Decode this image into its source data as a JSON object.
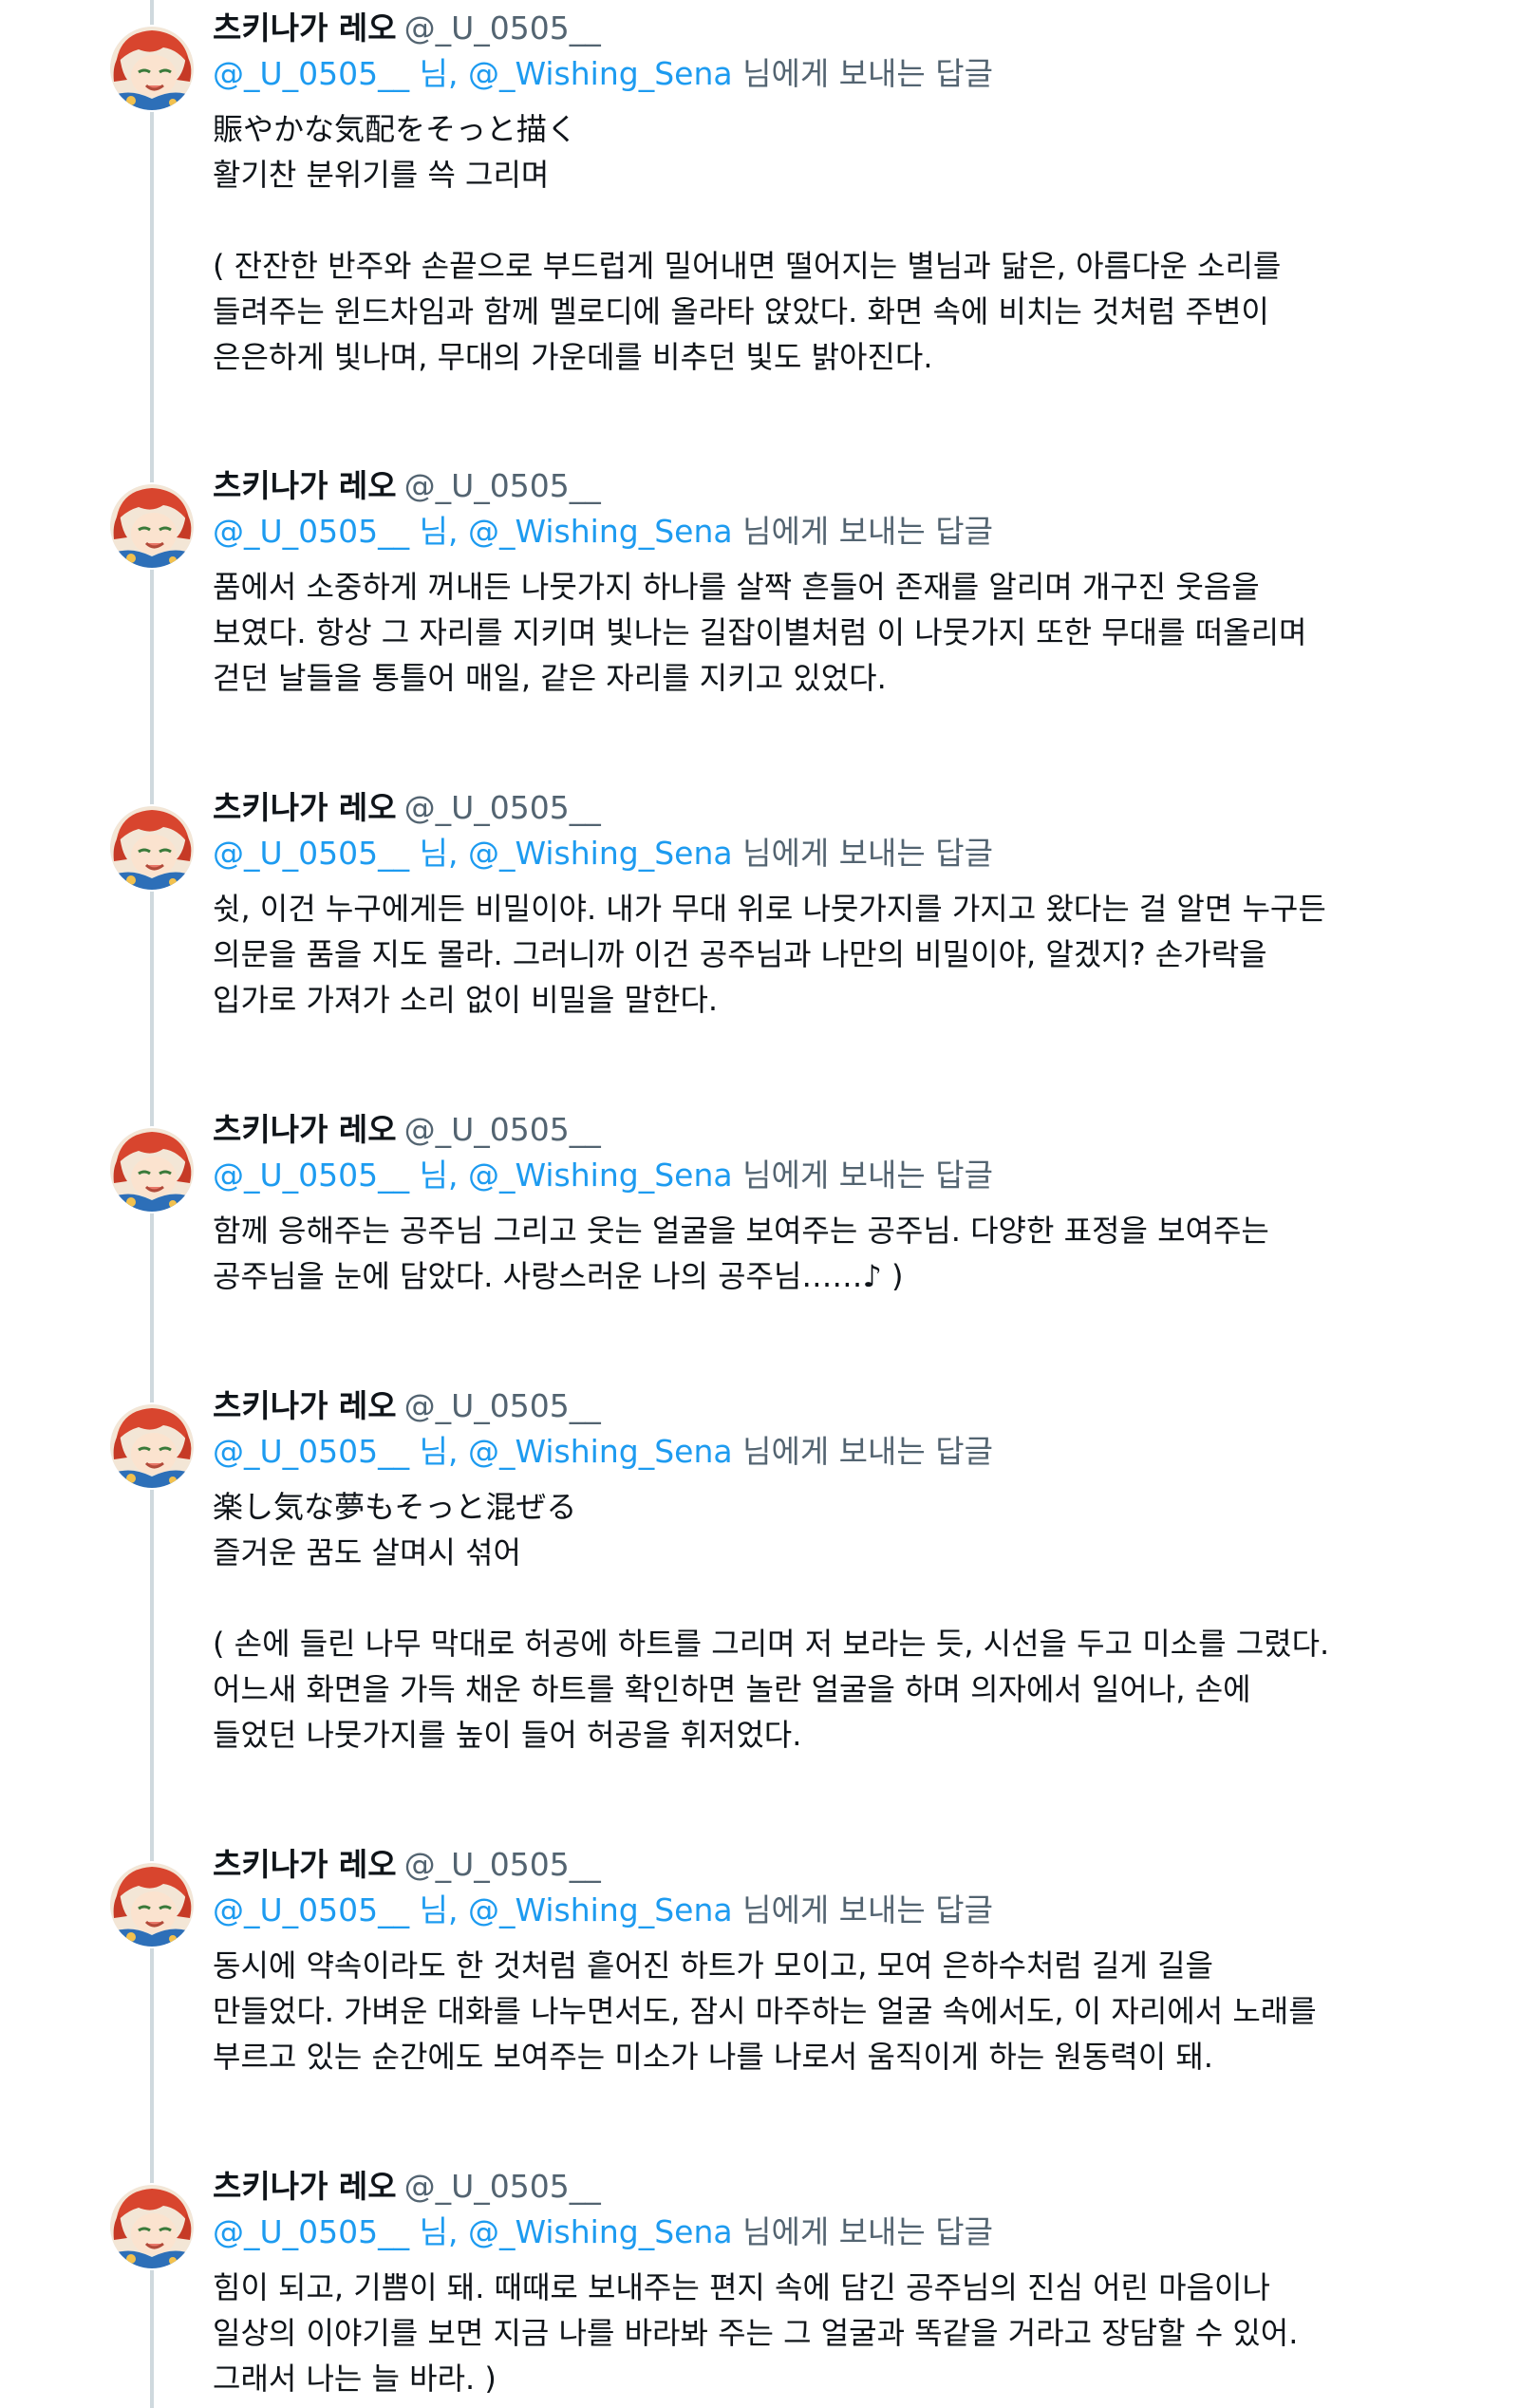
{
  "reply_label": "님에게 보내는 답글",
  "tweets": [
    {
      "display_name": "츠키나가 레오",
      "handle": "@_U_0505__",
      "mention_1": "@_U_0505__ 님,",
      "mention_2": "@_Wishing_Sena",
      "text": "賑やかな気配をそっと描く\n활기찬 분위기를 쓱 그리며\n\n( 잔잔한 반주와 손끝으로 부드럽게 밀어내면 떨어지는 별님과 닮은, 아름다운 소리를\n들려주는 윈드차임과 함께 멜로디에 올라타 앉았다. 화면 속에 비치는 것처럼 주변이\n은은하게 빛나며, 무대의 가운데를 비추던 빛도 밝아진다."
    },
    {
      "display_name": "츠키나가 레오",
      "handle": "@_U_0505__",
      "mention_1": "@_U_0505__ 님,",
      "mention_2": "@_Wishing_Sena",
      "text": "품에서 소중하게 꺼내든 나뭇가지 하나를 살짝 흔들어 존재를 알리며 개구진 웃음을\n보였다. 항상 그 자리를 지키며 빛나는 길잡이별처럼 이 나뭇가지 또한 무대를 떠올리며\n걷던 날들을 통틀어 매일, 같은 자리를 지키고 있었다."
    },
    {
      "display_name": "츠키나가 레오",
      "handle": "@_U_0505__",
      "mention_1": "@_U_0505__ 님,",
      "mention_2": "@_Wishing_Sena",
      "text": "쉿, 이건 누구에게든 비밀이야. 내가 무대 위로 나뭇가지를 가지고 왔다는 걸 알면 누구든\n의문을 품을 지도 몰라. 그러니까 이건 공주님과 나만의 비밀이야, 알겠지? 손가락을\n입가로 가져가 소리 없이 비밀을 말한다."
    },
    {
      "display_name": "츠키나가 레오",
      "handle": "@_U_0505__",
      "mention_1": "@_U_0505__ 님,",
      "mention_2": "@_Wishing_Sena",
      "text": "함께 응해주는 공주님 그리고 웃는 얼굴을 보여주는 공주님. 다양한 표정을 보여주는\n공주님을 눈에 담았다. 사랑스러운 나의 공주님……♪ )"
    },
    {
      "display_name": "츠키나가 레오",
      "handle": "@_U_0505__",
      "mention_1": "@_U_0505__ 님,",
      "mention_2": "@_Wishing_Sena",
      "text": "楽し気な夢もそっと混ぜる\n즐거운 꿈도 살며시 섞어\n\n( 손에 들린 나무 막대로 허공에 하트를 그리며 저 보라는 듯, 시선을 두고 미소를 그렸다.\n어느새 화면을 가득 채운 하트를 확인하면 놀란 얼굴을 하며 의자에서 일어나, 손에\n들었던 나뭇가지를 높이 들어 허공을 휘저었다."
    },
    {
      "display_name": "츠키나가 레오",
      "handle": "@_U_0505__",
      "mention_1": "@_U_0505__ 님,",
      "mention_2": "@_Wishing_Sena",
      "text": "동시에 약속이라도 한 것처럼 흩어진 하트가 모이고, 모여 은하수처럼 길게 길을\n만들었다. 가벼운 대화를 나누면서도, 잠시 마주하는 얼굴 속에서도, 이 자리에서 노래를\n부르고 있는 순간에도 보여주는 미소가 나를 나로서 움직이게 하는 원동력이 돼."
    },
    {
      "display_name": "츠키나가 레오",
      "handle": "@_U_0505__",
      "mention_1": "@_U_0505__ 님,",
      "mention_2": "@_Wishing_Sena",
      "text": "힘이 되고, 기쁨이 돼. 때때로 보내주는 편지 속에 담긴 공주님의 진심 어린 마음이나\n일상의 이야기를 보면 지금 나를 바라봐 주는 그 얼굴과 똑같을 거라고 장담할 수 있어.\n그래서 나는 늘 바라. )"
    }
  ],
  "colors": {
    "text": "#0f1419",
    "secondary": "#536471",
    "link": "#1d9bf0",
    "thread_line": "#cfd9de"
  },
  "icons": {
    "avatar": "avatar-icon"
  }
}
